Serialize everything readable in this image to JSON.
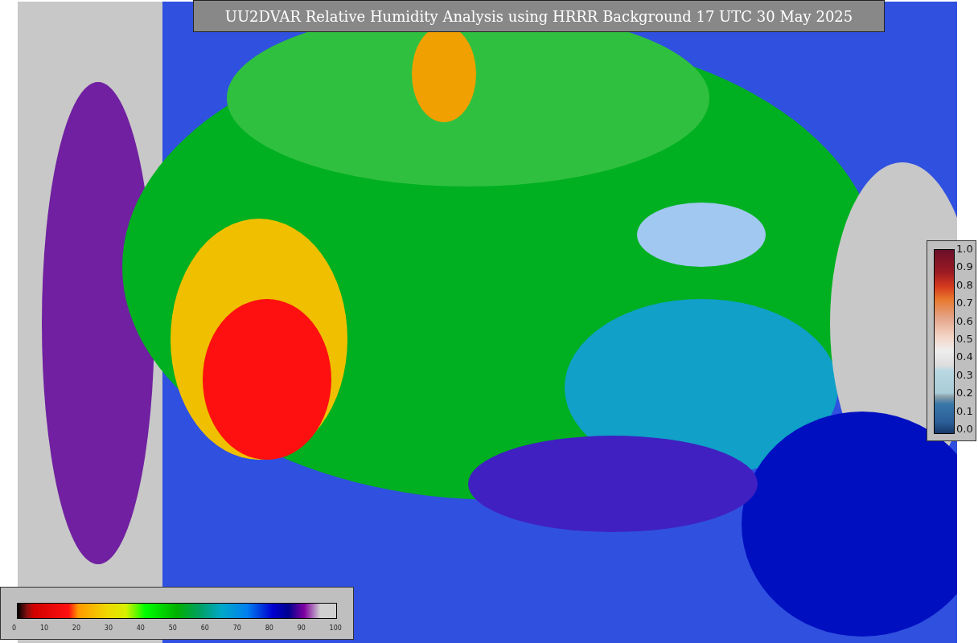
{
  "title": "UU2DVAR Relative Humidity Analysis using HRRR Background 17 UTC 30 May 2025",
  "observation_colorbar": {
    "ticks": [
      "1.0",
      "0.9",
      "0.8",
      "0.7",
      "0.6",
      "0.5",
      "0.4",
      "0.3",
      "0.2",
      "0.1",
      "0.0"
    ]
  },
  "analysis_colorbar": {
    "ticks": [
      "0",
      "10",
      "20",
      "30",
      "40",
      "50",
      "60",
      "70",
      "80",
      "90",
      "100"
    ]
  }
}
